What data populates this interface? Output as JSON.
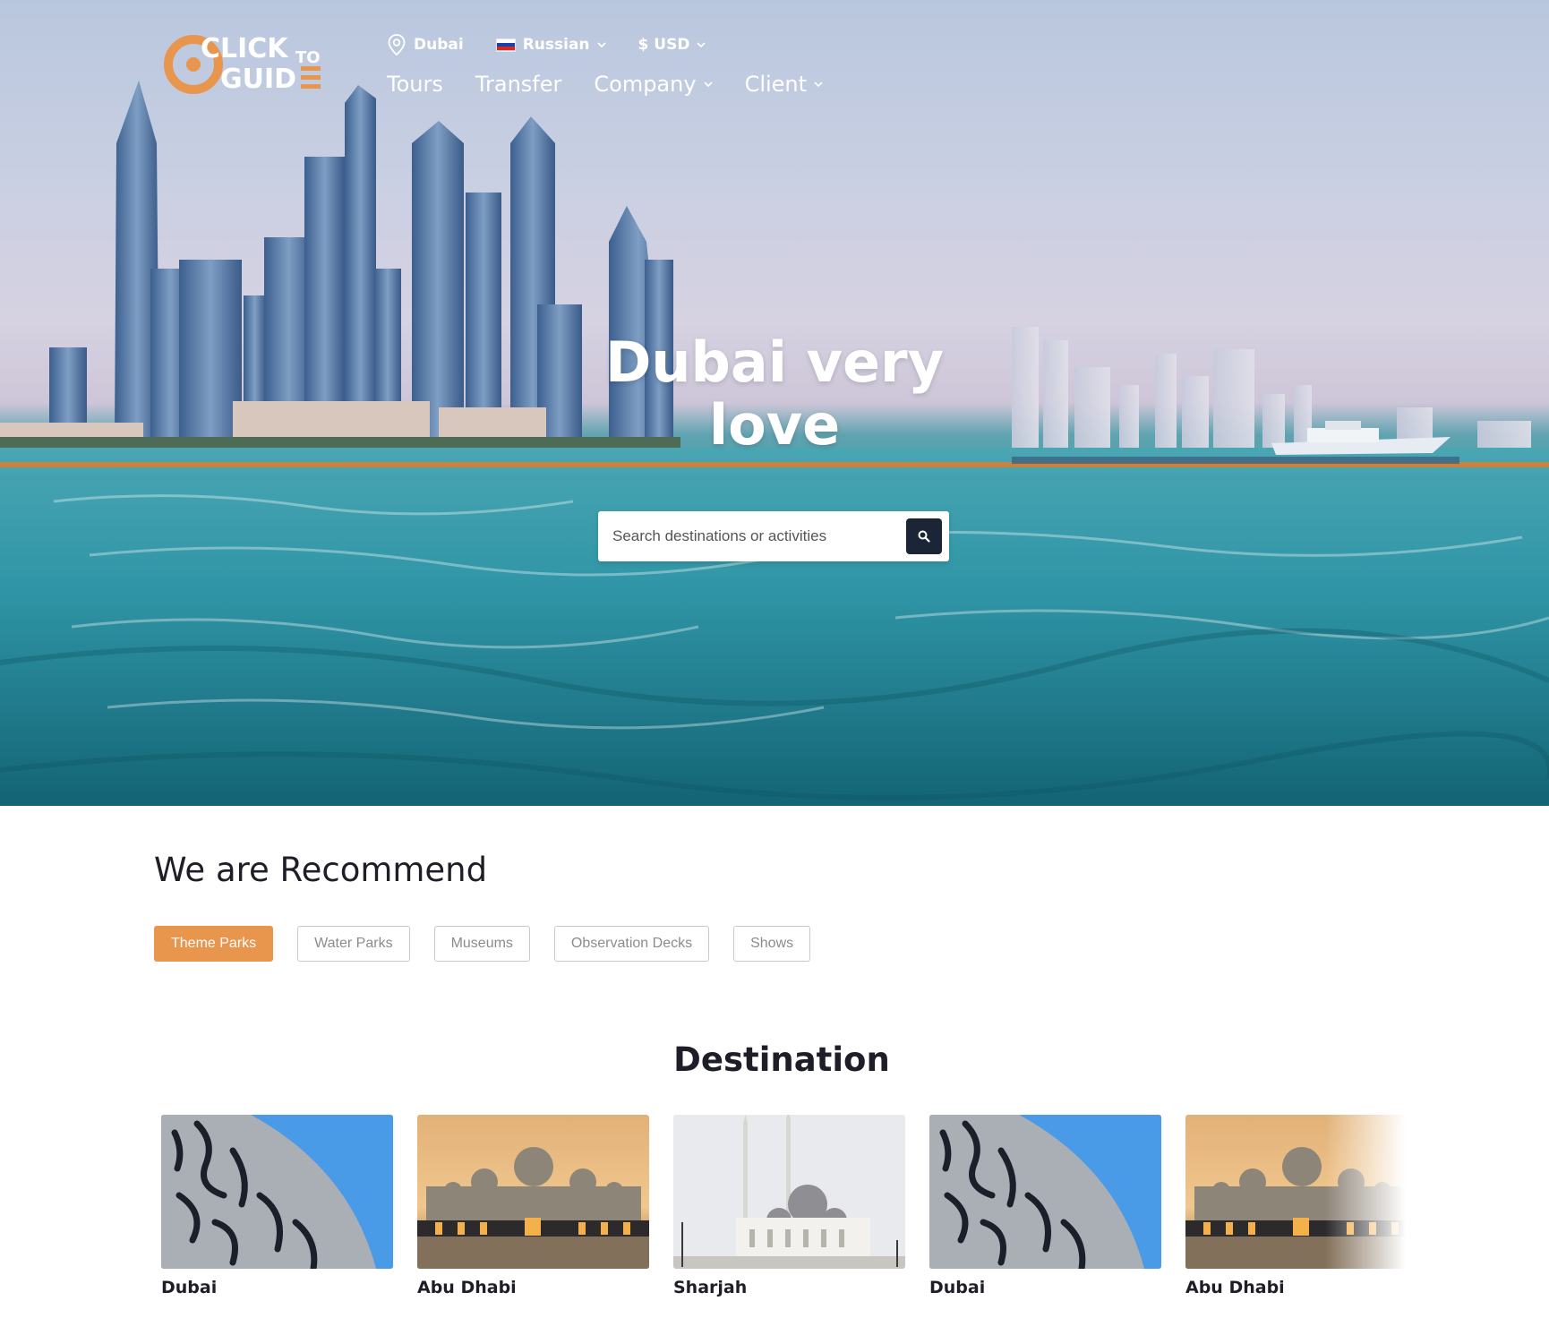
{
  "header": {
    "logo_alt": "CLICK TO GUIDE",
    "location": "Dubai",
    "language": "Russian",
    "currency": "$ USD",
    "nav": [
      {
        "label": "Tours"
      },
      {
        "label": "Transfer"
      },
      {
        "label": "Company"
      },
      {
        "label": "Client"
      }
    ]
  },
  "hero": {
    "title": "Dubai very love",
    "search": {
      "placeholder": "Search destinations or activities"
    }
  },
  "recommend": {
    "title": "We are Recommend",
    "filters": [
      {
        "label": "Theme Parks",
        "active": true
      },
      {
        "label": "Water Parks",
        "active": false
      },
      {
        "label": "Museums",
        "active": false
      },
      {
        "label": "Observation Decks",
        "active": false
      },
      {
        "label": "Shows",
        "active": false
      }
    ]
  },
  "destination": {
    "title": "Destination",
    "cards": [
      {
        "name": "Dubai",
        "image": "calligraphy-dome"
      },
      {
        "name": "Abu Dhabi",
        "image": "grand-mosque-sunset"
      },
      {
        "name": "Sharjah",
        "image": "white-mosque"
      },
      {
        "name": "Dubai",
        "image": "calligraphy-dome"
      },
      {
        "name": "Abu Dhabi",
        "image": "grand-mosque-sunset"
      }
    ]
  },
  "colors": {
    "accent": "#e8954d",
    "search_button": "#1b2536",
    "text_dark": "#1e1e28"
  },
  "icons": [
    "location-pin-icon",
    "russia-flag-icon",
    "chevron-down-icon",
    "search-icon"
  ]
}
